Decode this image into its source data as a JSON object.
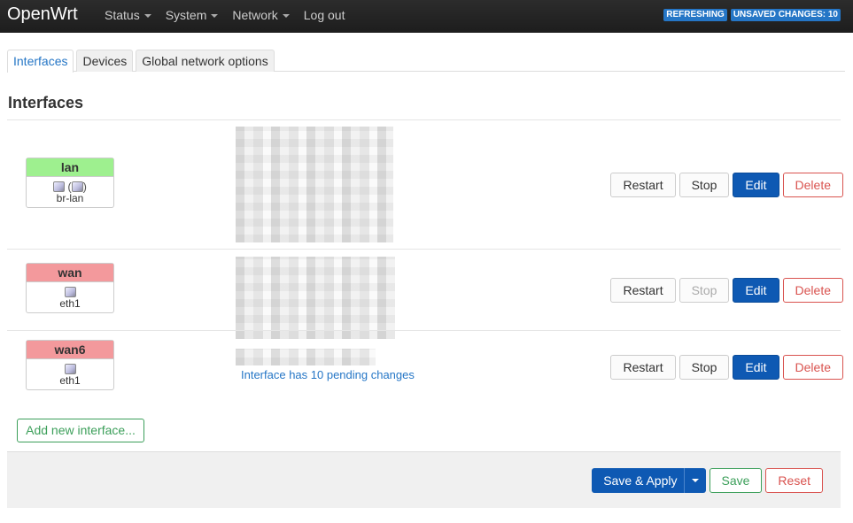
{
  "brand": "OpenWrt",
  "nav": {
    "status": "Status",
    "system": "System",
    "network": "Network",
    "logout": "Log out"
  },
  "badges": {
    "refreshing": "REFRESHING",
    "unsaved": "UNSAVED CHANGES: 10"
  },
  "tabs": [
    "Interfaces",
    "Devices",
    "Global network options"
  ],
  "section_title": "Interfaces",
  "interfaces": [
    {
      "name": "lan",
      "status_color": "#9ef08f",
      "device": "br-lan",
      "icons": [
        "ethernet-icon",
        "bridge-icon"
      ],
      "pending_note": "",
      "buttons": {
        "restart": "Restart",
        "stop": "Stop",
        "edit": "Edit",
        "delete": "Delete"
      },
      "stop_enabled": true
    },
    {
      "name": "wan",
      "status_color": "#f3999c",
      "device": "eth1",
      "icons": [
        "ethernet-icon"
      ],
      "pending_note": "",
      "buttons": {
        "restart": "Restart",
        "stop": "Stop",
        "edit": "Edit",
        "delete": "Delete"
      },
      "stop_enabled": false
    },
    {
      "name": "wan6",
      "status_color": "#f3999c",
      "device": "eth1",
      "icons": [
        "ethernet-icon"
      ],
      "pending_note": "Interface has 10 pending changes",
      "buttons": {
        "restart": "Restart",
        "stop": "Stop",
        "edit": "Edit",
        "delete": "Delete"
      },
      "stop_enabled": true
    }
  ],
  "add_interface": "Add new interface...",
  "footer": {
    "save_apply": "Save & Apply",
    "save": "Save",
    "reset": "Reset"
  },
  "colors": {
    "accent": "#0e59b3",
    "link": "#2576c6",
    "up": "#9ef08f",
    "down": "#f3999c",
    "delete": "#d9534f",
    "save": "#3c9f5a"
  }
}
